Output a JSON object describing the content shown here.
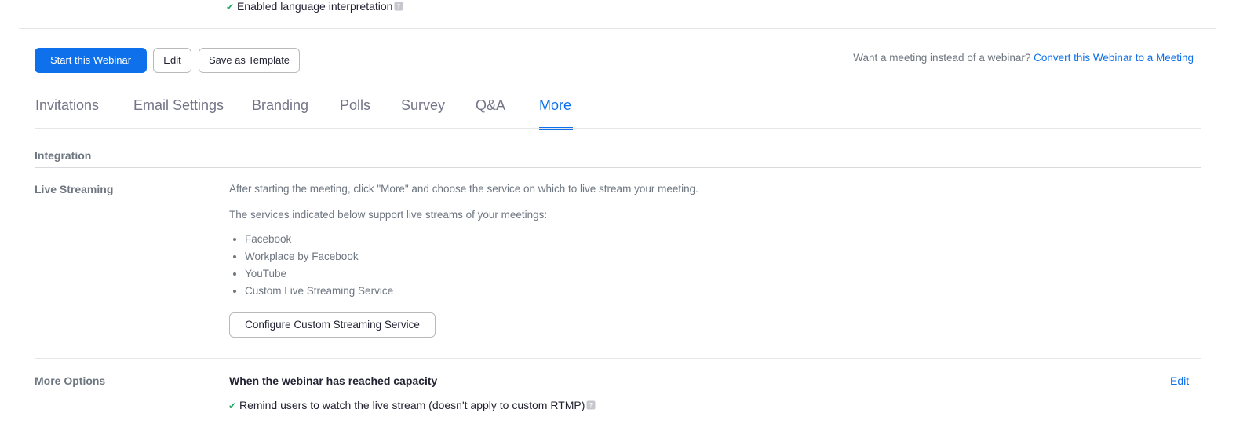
{
  "top_status": {
    "text": "Enabled language interpretation"
  },
  "actions": {
    "start_label": "Start this Webinar",
    "edit_label": "Edit",
    "save_template_label": "Save as Template"
  },
  "convert": {
    "prompt": "Want a meeting instead of a webinar?",
    "link": "Convert this Webinar to a Meeting"
  },
  "tabs": [
    {
      "label": "Invitations"
    },
    {
      "label": "Email Settings"
    },
    {
      "label": "Branding"
    },
    {
      "label": "Polls"
    },
    {
      "label": "Survey"
    },
    {
      "label": "Q&A"
    },
    {
      "label": "More"
    }
  ],
  "active_tab": "More",
  "integration": {
    "heading": "Integration"
  },
  "live_streaming": {
    "label": "Live Streaming",
    "line1": "After starting the meeting, click \"More\" and choose the service on which to live stream your meeting.",
    "line2": "The services indicated below support live streams of your meetings:",
    "services": [
      "Facebook",
      "Workplace by Facebook",
      "YouTube",
      "Custom Live Streaming Service"
    ],
    "configure_button": "Configure Custom Streaming Service"
  },
  "more_options": {
    "label": "More Options",
    "heading": "When the webinar has reached capacity",
    "edit_link": "Edit",
    "option_text": "Remind users to watch the live stream (doesn't apply to custom RTMP)"
  },
  "colors": {
    "accent": "#0e71eb",
    "check": "#23a566",
    "muted_text": "#6e7680"
  }
}
